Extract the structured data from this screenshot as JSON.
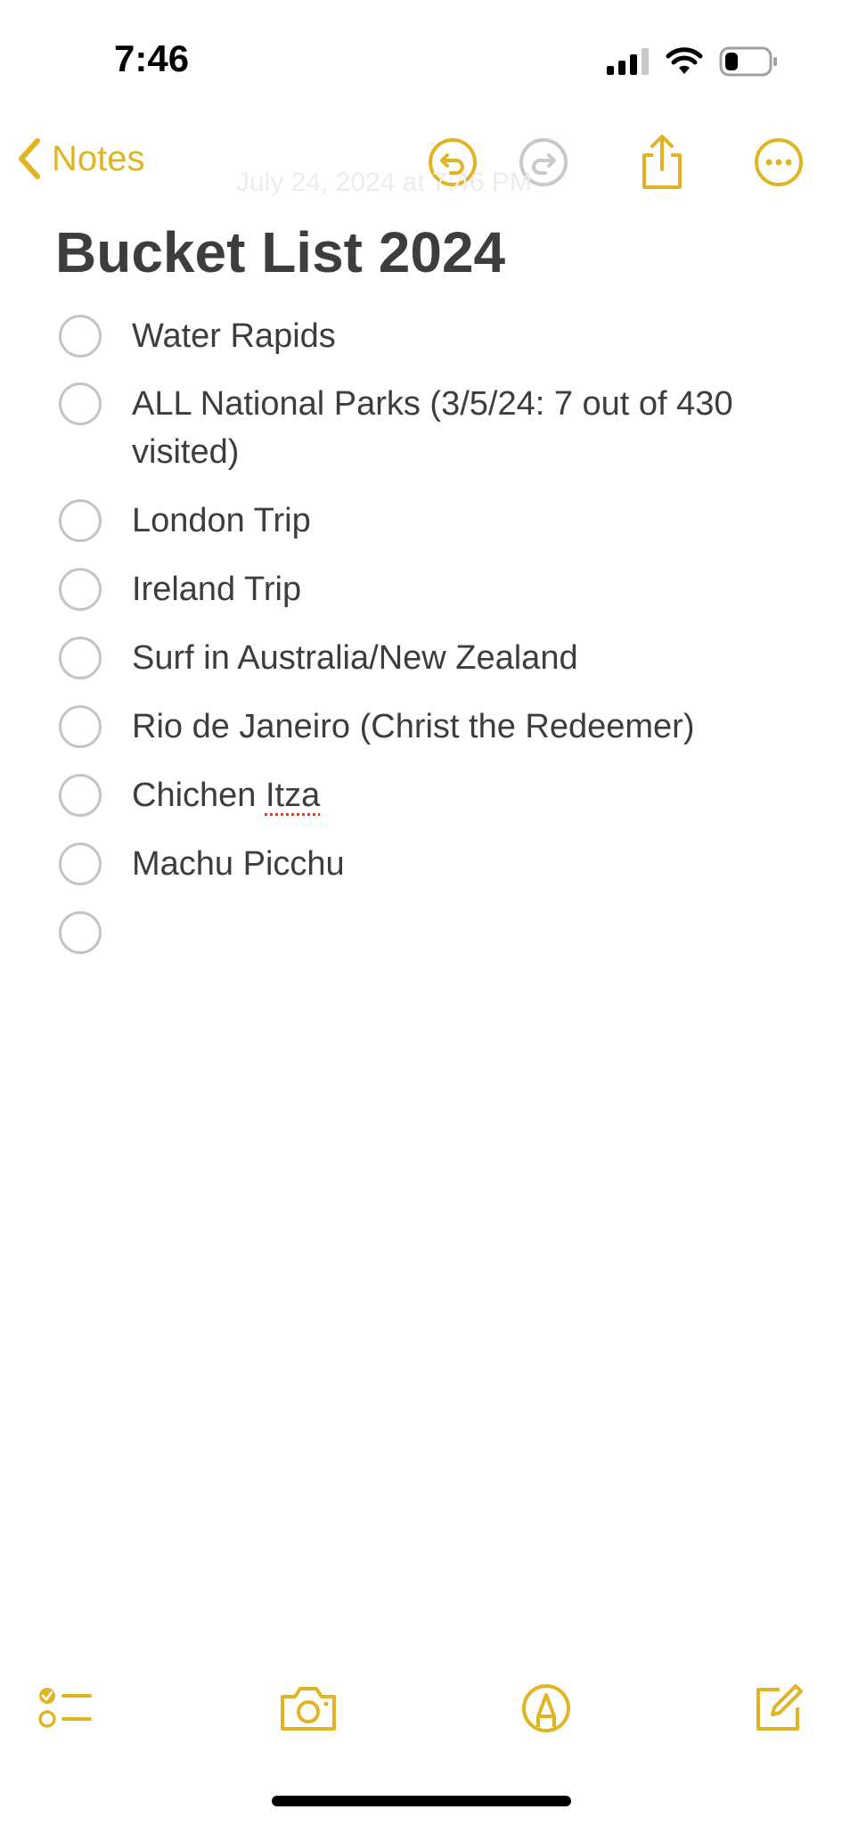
{
  "status": {
    "time": "7:46"
  },
  "nav": {
    "back_label": "Notes",
    "date_text": "July 24, 2024 at 7:46 PM"
  },
  "note": {
    "title": "Bucket List 2024",
    "items": [
      {
        "text": "Water Rapids"
      },
      {
        "text": "ALL National Parks (3/5/24: 7 out of 430 visited)"
      },
      {
        "text": "London Trip"
      },
      {
        "text": "Ireland Trip"
      },
      {
        "text": "Surf in Australia/New Zealand"
      },
      {
        "text": "Rio de Janeiro (Christ the Redeemer)"
      },
      {
        "text_before": "Chichen ",
        "text_misspelled": "Itza"
      },
      {
        "text": "Machu Picchu"
      },
      {
        "text": ""
      }
    ]
  },
  "icons": {
    "back": "chevron-left-icon",
    "undo": "undo-icon",
    "redo": "redo-icon",
    "share": "share-icon",
    "more": "more-icon",
    "checklist": "checklist-icon",
    "camera": "camera-icon",
    "markup": "markup-icon",
    "compose": "compose-icon"
  },
  "colors": {
    "accent": "#e0b422",
    "text": "#3d3d3d",
    "checkbox": "#c4c4c4",
    "spellcheck": "#e23b2b"
  }
}
